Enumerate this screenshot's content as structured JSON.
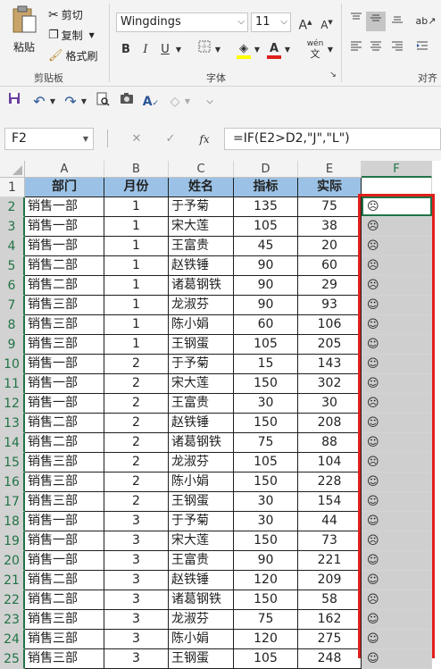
{
  "ribbon": {
    "clipboard": {
      "paste": "粘贴",
      "cut": "剪切",
      "copy": "复制",
      "format_painter": "格式刷",
      "group_label": "剪贴板"
    },
    "font": {
      "font_name": "Wingdings",
      "font_size": "11",
      "bold": "B",
      "italic": "I",
      "underline": "U",
      "group_label": "字体",
      "grow": "A",
      "shrink": "A",
      "phonetic": "wén"
    },
    "alignment": {
      "group_label": "对齐"
    }
  },
  "formula_bar": {
    "name_box": "F2",
    "fx": "fx",
    "cancel": "✕",
    "enter": "✓",
    "formula": "=IF(E2>D2,\"J\",\"L\")"
  },
  "columns": [
    "A",
    "B",
    "C",
    "D",
    "E",
    "F"
  ],
  "headers": [
    "部门",
    "月份",
    "姓名",
    "指标",
    "实际",
    ""
  ],
  "rows": [
    [
      "销售一部",
      "1",
      "于予菊",
      "135",
      "75",
      "☹"
    ],
    [
      "销售一部",
      "1",
      "宋大莲",
      "105",
      "38",
      "☹"
    ],
    [
      "销售一部",
      "1",
      "王富贵",
      "45",
      "20",
      "☹"
    ],
    [
      "销售二部",
      "1",
      "赵铁锤",
      "90",
      "60",
      "☹"
    ],
    [
      "销售二部",
      "1",
      "诸葛钢铁",
      "90",
      "29",
      "☹"
    ],
    [
      "销售三部",
      "1",
      "龙淑芬",
      "90",
      "93",
      "☺"
    ],
    [
      "销售三部",
      "1",
      "陈小娟",
      "60",
      "106",
      "☺"
    ],
    [
      "销售三部",
      "1",
      "王钢蛋",
      "105",
      "205",
      "☺"
    ],
    [
      "销售一部",
      "2",
      "于予菊",
      "15",
      "143",
      "☺"
    ],
    [
      "销售一部",
      "2",
      "宋大莲",
      "150",
      "302",
      "☺"
    ],
    [
      "销售一部",
      "2",
      "王富贵",
      "30",
      "30",
      "☹"
    ],
    [
      "销售二部",
      "2",
      "赵铁锤",
      "150",
      "208",
      "☺"
    ],
    [
      "销售二部",
      "2",
      "诸葛钢铁",
      "75",
      "88",
      "☺"
    ],
    [
      "销售三部",
      "2",
      "龙淑芬",
      "105",
      "104",
      "☹"
    ],
    [
      "销售三部",
      "2",
      "陈小娟",
      "150",
      "228",
      "☺"
    ],
    [
      "销售三部",
      "2",
      "王钢蛋",
      "30",
      "154",
      "☺"
    ],
    [
      "销售一部",
      "3",
      "于予菊",
      "30",
      "44",
      "☺"
    ],
    [
      "销售一部",
      "3",
      "宋大莲",
      "150",
      "73",
      "☹"
    ],
    [
      "销售一部",
      "3",
      "王富贵",
      "90",
      "221",
      "☺"
    ],
    [
      "销售二部",
      "3",
      "赵铁锤",
      "120",
      "209",
      "☺"
    ],
    [
      "销售二部",
      "3",
      "诸葛钢铁",
      "150",
      "58",
      "☹"
    ],
    [
      "销售三部",
      "3",
      "龙淑芬",
      "75",
      "162",
      "☺"
    ],
    [
      "销售三部",
      "3",
      "陈小娟",
      "120",
      "275",
      "☺"
    ],
    [
      "销售三部",
      "3",
      "王钢蛋",
      "105",
      "248",
      "☺"
    ]
  ],
  "colors": {
    "header_fill": "#9bc2e6",
    "selection_gray": "#cfcfcf",
    "highlight_border": "#e0201c",
    "accent": "#217346"
  }
}
